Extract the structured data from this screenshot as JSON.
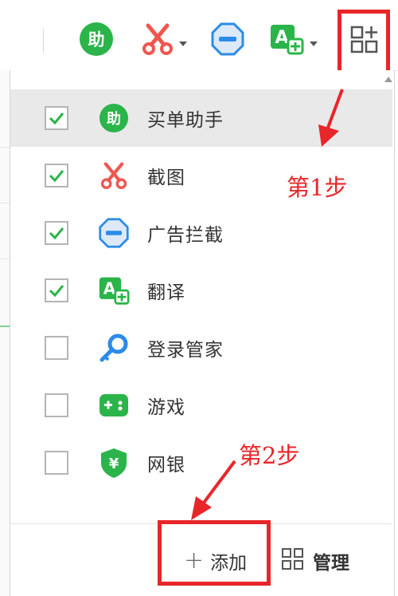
{
  "toolbar": {
    "items": [
      {
        "name": "assist",
        "icon": "assist-icon",
        "icon_text": "助",
        "color": "#2bb44a",
        "has_dropdown": false
      },
      {
        "name": "screenshot",
        "icon": "scissors-icon",
        "color": "#f0564f",
        "has_dropdown": true
      },
      {
        "name": "ad-block",
        "icon": "ad-block-icon",
        "color": "#2c8be8",
        "has_dropdown": false
      },
      {
        "name": "translate",
        "icon": "translate-icon",
        "icon_text": "A",
        "color": "#2bb44a",
        "has_dropdown": true
      },
      {
        "name": "extensions",
        "icon": "grid-plus-icon",
        "color": "#555555",
        "has_dropdown": false
      }
    ]
  },
  "menu": {
    "items": [
      {
        "label": "买单助手",
        "checked": true,
        "icon": "assist-icon",
        "icon_text": "助",
        "hovered": true
      },
      {
        "label": "截图",
        "checked": true,
        "icon": "scissors-icon"
      },
      {
        "label": "广告拦截",
        "checked": true,
        "icon": "ad-block-icon"
      },
      {
        "label": "翻译",
        "checked": true,
        "icon": "translate-icon",
        "icon_text": "A"
      },
      {
        "label": "登录管家",
        "checked": false,
        "icon": "key-icon"
      },
      {
        "label": "游戏",
        "checked": false,
        "icon": "gamepad-icon"
      },
      {
        "label": "网银",
        "checked": false,
        "icon": "bank-shield-icon",
        "icon_text": "¥"
      }
    ],
    "add_label": "添加",
    "manage_label": "管理"
  },
  "annotations": {
    "step1": "第1步",
    "step2": "第2步",
    "color": "#e8262a"
  },
  "colors": {
    "check": "#2bb44a",
    "highlight": "#e8262a",
    "hover_row": "#e9e9e9"
  }
}
